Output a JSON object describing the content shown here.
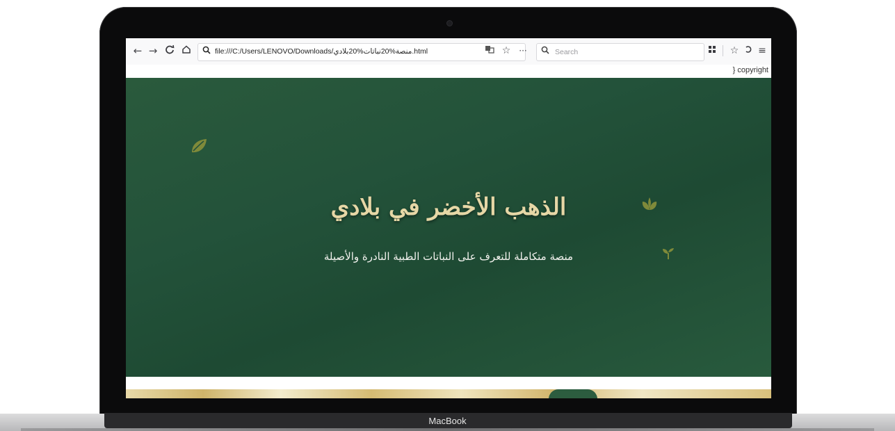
{
  "device": {
    "brand": "MacBook"
  },
  "browser": {
    "url": "file:///C:/Users/LENOVO/Downloads/منصة%20نباتات%20بلادي.html",
    "search_placeholder": "Search",
    "nav_icons": [
      "back-arrow-icon",
      "forward-arrow-icon",
      "reload-icon",
      "home-icon"
    ],
    "right_icons": [
      "translate-icon",
      "star-icon",
      "more-icon",
      "library-icon",
      "reader-icon",
      "sync-icon",
      "menu-icon"
    ]
  },
  "page": {
    "copyright": "} copyright",
    "hero_title": "الذهب الأخضر في بلادي",
    "hero_subtitle": "منصة متكاملة للتعرف على النباتات الطبية النادرة والأصيلة"
  },
  "colors": {
    "hero_green": "#23523a",
    "title_gold": "#e6d7a6",
    "leaf_olive": "#7f8a3a"
  }
}
